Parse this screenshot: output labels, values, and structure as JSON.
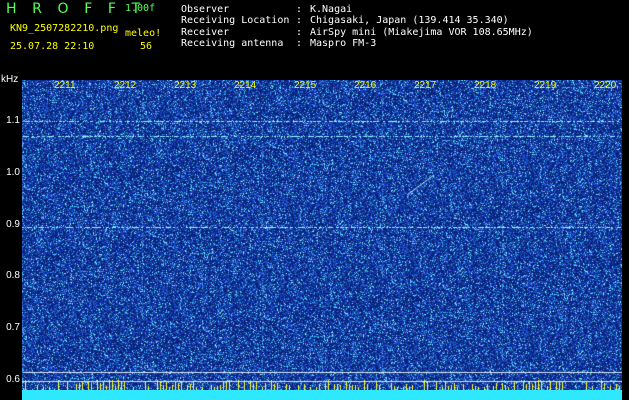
{
  "header": {
    "title": "H R O F F T",
    "version": "1.00f",
    "filename": "KN9_2507282210.png",
    "datetime": "25.07.28 22:10",
    "meleo_label": "meleo!",
    "meleo_count": "56"
  },
  "meta": [
    {
      "label": "Observer",
      "value": "K.Nagai"
    },
    {
      "label": "Receiving Location",
      "value": "Chigasaki, Japan (139.414 35.340)"
    },
    {
      "label": "Receiver",
      "value": "AirSpy mini (Miakejima VOR 108.65MHz)"
    },
    {
      "label": "Receiving antenna",
      "value": "Maspro FM-3"
    }
  ],
  "meta_sep": ":",
  "spectrogram": {
    "ylabel": "kHz",
    "yticks": [
      "1.1",
      "1.0",
      "0.9",
      "0.8",
      "0.7",
      "0.6"
    ],
    "ylim": [
      0.58,
      1.18
    ],
    "time_labels": [
      "2211",
      "2212",
      "2213",
      "2214",
      "2215",
      "2216",
      "2217",
      "2218",
      "2219",
      "2220"
    ],
    "time_range": [
      "2210",
      "2220"
    ],
    "carrier_lines_khz": [
      1.1,
      1.072,
      0.895
    ],
    "reference_lines_khz": [
      0.615,
      0.598
    ],
    "colors": {
      "background": "#0a1a6e",
      "noise_low": "#1e3cb4",
      "noise_high": "#8ef7ff",
      "bottom_strip": "#2ee8ff",
      "tick_label": "#ffffff",
      "time_label": "#ffff00"
    }
  }
}
